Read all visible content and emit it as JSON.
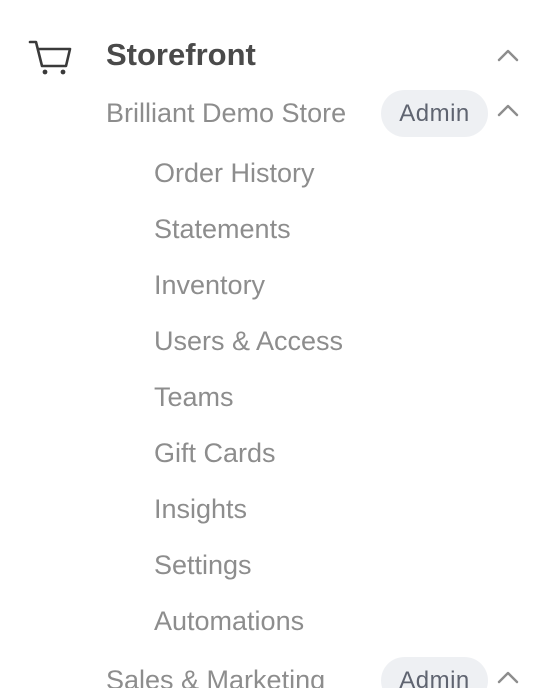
{
  "section": {
    "title": "Storefront",
    "icon": "shopping-cart-icon"
  },
  "stores": [
    {
      "name": "Brilliant Demo Store",
      "role": "Admin",
      "expanded": true,
      "items": [
        {
          "label": "Order History"
        },
        {
          "label": "Statements"
        },
        {
          "label": "Inventory"
        },
        {
          "label": "Users & Access"
        },
        {
          "label": "Teams"
        },
        {
          "label": "Gift Cards"
        },
        {
          "label": "Insights"
        },
        {
          "label": "Settings"
        },
        {
          "label": "Automations"
        }
      ]
    },
    {
      "name": "Sales & Marketing",
      "role": "Admin",
      "expanded": true,
      "items": []
    }
  ],
  "colors": {
    "title": "#4a4a4a",
    "text": "#8d8d8d",
    "badge_bg": "#eef0f3",
    "badge_text": "#5f6470"
  }
}
